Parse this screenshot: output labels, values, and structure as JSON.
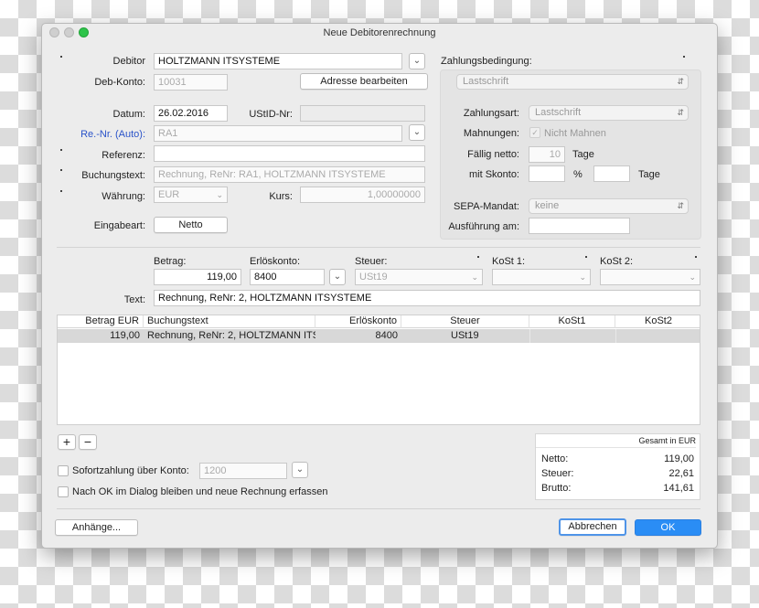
{
  "window": {
    "title": "Neue Debitorenrechnung"
  },
  "left": {
    "debitor": {
      "label": "Debitor",
      "value": "HOLTZMANN ITSYSTEME"
    },
    "deb_konto": {
      "label": "Deb-Konto:",
      "value": "10031"
    },
    "adresse_button": "Adresse bearbeiten",
    "datum": {
      "label": "Datum:",
      "value": "26.02.2016"
    },
    "ustid": {
      "label": "UStID-Nr:",
      "value": ""
    },
    "re_nr": {
      "label": "Re.-Nr. (Auto):",
      "value": "RA1"
    },
    "referenz": {
      "label": "Referenz:",
      "value": ""
    },
    "buchungstext": {
      "label": "Buchungstext:",
      "value": "Rechnung, ReNr: RA1, HOLTZMANN ITSYSTEME"
    },
    "waehrung": {
      "label": "Währung:",
      "value": "EUR"
    },
    "kurs": {
      "label": "Kurs:",
      "value": "1,00000000"
    },
    "eingabeart": {
      "label": "Eingabeart:",
      "value": "Netto"
    }
  },
  "right": {
    "zahlungsbedingung": {
      "label": "Zahlungsbedingung:",
      "value": "Lastschrift"
    },
    "zahlungsart": {
      "label": "Zahlungsart:",
      "value": "Lastschrift"
    },
    "mahnungen": {
      "label": "Mahnungen:",
      "value": "Nicht Mahnen"
    },
    "faellig_netto": {
      "label": "Fällig netto:",
      "value": "10",
      "unit": "Tage"
    },
    "skonto": {
      "label": "mit Skonto:",
      "percent": "%",
      "unit": "Tage"
    },
    "sepa": {
      "label": "SEPA-Mandat:",
      "value": "keine"
    },
    "ausfuehrung": {
      "label": "Ausführung am:",
      "value": ""
    }
  },
  "entry": {
    "betrag": {
      "label": "Betrag:",
      "value": "119,00"
    },
    "erloeskonto": {
      "label": "Erlöskonto:",
      "value": "8400"
    },
    "steuer": {
      "label": "Steuer:",
      "value": "USt19"
    },
    "kost1": {
      "label": "KoSt 1:"
    },
    "kost2": {
      "label": "KoSt 2:"
    },
    "text": {
      "label": "Text:",
      "value": "Rechnung, ReNr: 2, HOLTZMANN ITSYSTEME"
    }
  },
  "table": {
    "columns": [
      "Betrag EUR",
      "Buchungstext",
      "Erlöskonto",
      "Steuer",
      "KoSt1",
      "KoSt2"
    ],
    "rows": [
      [
        "119,00",
        "Rechnung, ReNr: 2, HOLTZMANN ITS...",
        "8400",
        "USt19",
        "",
        ""
      ]
    ]
  },
  "list_buttons": {
    "add": "+",
    "remove": "−"
  },
  "sofortzahlung": {
    "label": "Sofortzahlung über Konto:",
    "value": "1200"
  },
  "stay_checkbox": {
    "label": "Nach OK im Dialog bleiben und neue Rechnung erfassen"
  },
  "totals": {
    "header": "Gesamt in EUR",
    "netto": {
      "label": "Netto:",
      "value": "119,00"
    },
    "steuer": {
      "label": "Steuer:",
      "value": "22,61"
    },
    "brutto": {
      "label": "Brutto:",
      "value": "141,61"
    }
  },
  "footer": {
    "anhaenge": "Anhänge...",
    "abbrechen": "Abbrechen",
    "ok": "OK"
  },
  "colors": {
    "accent": "#2a8df5",
    "link_blue": "#2a53c9",
    "traffic_green": "#2ec44a"
  }
}
